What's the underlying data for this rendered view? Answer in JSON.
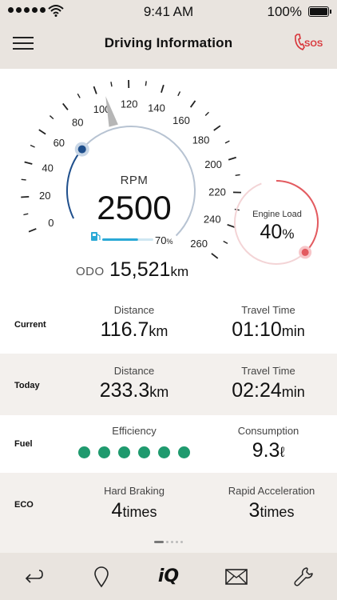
{
  "status_bar": {
    "time": "9:41 AM",
    "battery": "100%"
  },
  "header": {
    "title": "Driving Information",
    "sos_label": "SOS"
  },
  "gauge": {
    "speed_ticks": [
      "0",
      "20",
      "40",
      "60",
      "80",
      "100",
      "120",
      "140",
      "160",
      "180",
      "200",
      "220",
      "240",
      "260"
    ],
    "rpm_label": "RPM",
    "rpm_value": "2500",
    "fuel_percent_value": "70",
    "fuel_percent_unit": "%",
    "fuel_fraction": 0.7,
    "odo_label": "ODO",
    "odo_value": "15,521",
    "odo_unit": "km",
    "engine_load_label": "Engine Load",
    "engine_load_value": "40",
    "engine_load_unit": "%",
    "engine_load_fraction": 0.4
  },
  "rows": [
    {
      "label": "Current",
      "left": {
        "caption": "Distance",
        "value": "116.7",
        "unit": "km"
      },
      "right": {
        "caption": "Travel Time",
        "value": "01:10",
        "unit": "min"
      }
    },
    {
      "label": "Today",
      "left": {
        "caption": "Distance",
        "value": "233.3",
        "unit": "km"
      },
      "right": {
        "caption": "Travel Time",
        "value": "02:24",
        "unit": "min"
      }
    },
    {
      "label": "Fuel",
      "left": {
        "caption": "Efficiency",
        "dots": 6
      },
      "right": {
        "caption": "Consumption",
        "value": "9.3",
        "unit": "ℓ"
      }
    },
    {
      "label": "ECO",
      "left": {
        "caption": "Hard Braking",
        "value": "4",
        "unit": "times"
      },
      "right": {
        "caption": "Rapid Acceleration",
        "value": "3",
        "unit": "times"
      }
    }
  ],
  "pager": {
    "pages": 5,
    "current": 1
  },
  "tabs": [
    {
      "icon": "back-arrow-icon"
    },
    {
      "icon": "location-pin-icon"
    },
    {
      "icon": "iq-icon",
      "label": "iQ"
    },
    {
      "icon": "envelope-icon"
    },
    {
      "icon": "wrench-icon"
    }
  ],
  "colors": {
    "header_bg": "#e9e4df",
    "row_shade": "#f3f0ed",
    "eco_green": "#1f9a6e",
    "gauge_blue": "#1f4f8c",
    "gauge_track": "#b7c3d2",
    "engine_red": "#e35b60",
    "fuel_cyan": "#2aa9d6",
    "sos_red": "#d8353a"
  }
}
